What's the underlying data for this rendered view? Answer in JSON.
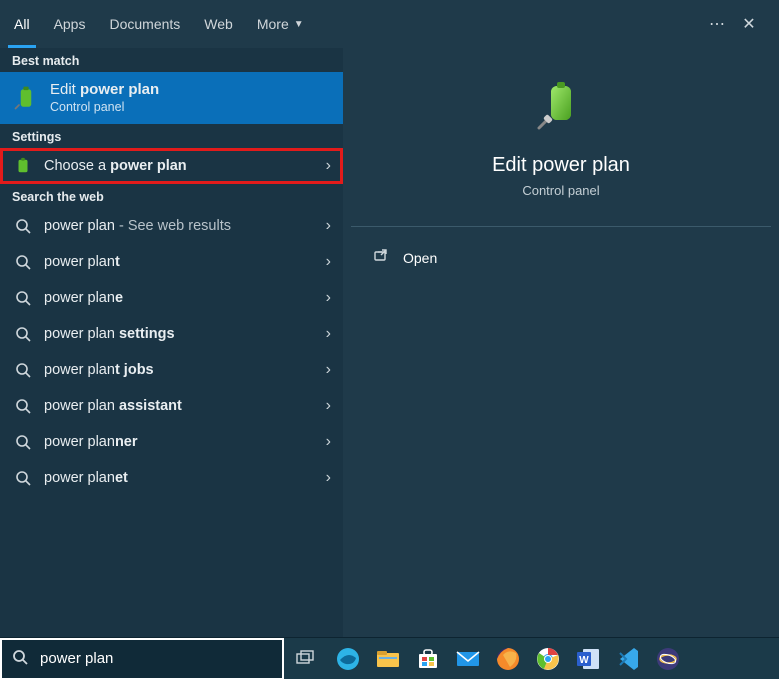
{
  "tabs": {
    "all": "All",
    "apps": "Apps",
    "documents": "Documents",
    "web": "Web",
    "more": "More"
  },
  "sections": {
    "best": "Best match",
    "settings": "Settings",
    "web": "Search the web"
  },
  "best": {
    "prefix": "Edit ",
    "bold": "power plan",
    "sub": "Control panel"
  },
  "settings_item": {
    "prefix": "Choose a ",
    "bold": "power plan"
  },
  "web": [
    {
      "plain": "power plan",
      "suffix": " - See web results"
    },
    {
      "plain": "power plan",
      "bold_tail": "t"
    },
    {
      "plain": "power plan",
      "bold_tail": "e"
    },
    {
      "plain": "power plan ",
      "bold_tail": "settings"
    },
    {
      "plain": "power plan",
      "bold_mid": "t",
      "bold_tail": " jobs"
    },
    {
      "plain": "power plan ",
      "bold_tail": "assistant"
    },
    {
      "plain": "power plan",
      "bold_tail": "ner"
    },
    {
      "plain": "power plan",
      "bold_tail": "et"
    }
  ],
  "preview": {
    "title": "Edit power plan",
    "sub": "Control panel",
    "open": "Open"
  },
  "search": {
    "value": "power plan"
  },
  "colors": {
    "edge": "#2db3e6",
    "files": "#f8c34b",
    "store": "#ffffff",
    "mail": "#2196e8",
    "firefox": "#f58a2a",
    "chrome": "#ffffff",
    "word": "#2a5fce",
    "vscode": "#37a8ea",
    "eclipse": "#3d3a7a"
  }
}
